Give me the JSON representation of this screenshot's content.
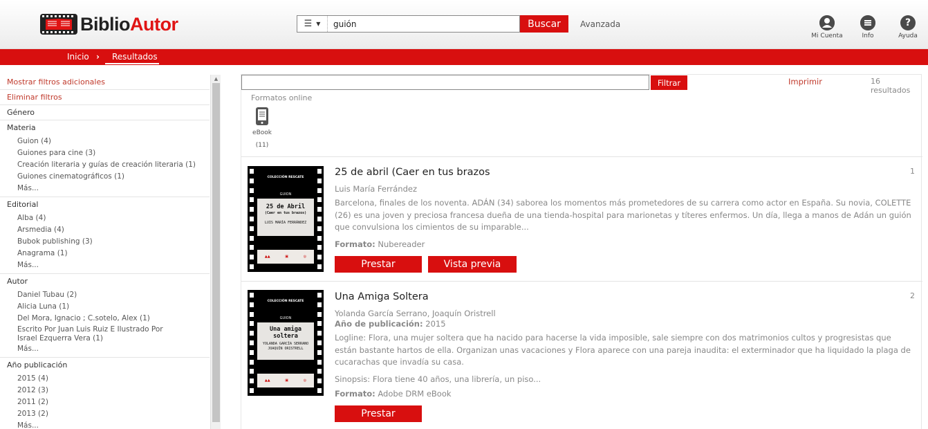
{
  "header": {
    "logo": {
      "part1": "Biblio",
      "part2": "Autor"
    },
    "search": {
      "value": "guión",
      "button": "Buscar",
      "menu_icon": "hamburger-icon"
    },
    "advanced": "Avanzada",
    "icons": [
      {
        "label": "Mi Cuenta",
        "icon": "user-icon"
      },
      {
        "label": "Info",
        "icon": "menu-icon"
      },
      {
        "label": "Ayuda",
        "icon": "help-icon"
      }
    ]
  },
  "nav": {
    "home": "Inicio",
    "separator": "›",
    "current": "Resultados"
  },
  "sidebar": {
    "more_filters": "Mostrar filtros adicionales",
    "clear_filters": "Eliminar filtros",
    "genre": "Género",
    "materia": {
      "title": "Materia",
      "items": [
        "Guion (4)",
        "Guiones para cine (3)",
        "Creación literaria y guías de creación literaria (1)",
        "Guiones cinematográficos (1)"
      ],
      "more": "Más..."
    },
    "editorial": {
      "title": "Editorial",
      "items": [
        "Alba (4)",
        "Arsmedia (4)",
        "Bubok publishing (3)",
        "Anagrama (1)"
      ],
      "more": "Más..."
    },
    "autor": {
      "title": "Autor",
      "items": [
        "Daniel Tubau (2)",
        "Alicia Luna (1)",
        "Del Mora, Ignacio ; C.sotelo, Alex (1)",
        "Escrito Por Juan Luis Ruiz E Ilustrado Por Israel Ezquerra Vera (1)"
      ],
      "more": "Más..."
    },
    "year": {
      "title": "Año publicación",
      "items": [
        "2015 (4)",
        "2012 (3)",
        "2011 (2)",
        "2013 (2)"
      ],
      "more": "Más..."
    }
  },
  "results": {
    "filter_button": "Filtrar",
    "print": "Imprimir",
    "count": "16 resultados",
    "formats_label": "Formatos online",
    "ebook_label": "eBook",
    "ebook_count": "(11)",
    "items": [
      {
        "number": "1",
        "title": "25 de abril (Caer en tus brazos",
        "author": "Luis María Ferrández",
        "description": "Barcelona, finales de los noventa. ADÁN (34) saborea los momentos más prometedores de su carrera como actor en España. Su novia, COLETTE (26) es una joven y preciosa francesa dueña de una tienda-hospital para marionetas y títeres enfermos. Un día, llega a manos de Adán un guión que convulsiona los cimientos de su imparable...",
        "format_label": "Formato:",
        "format_value": "Nubereader",
        "borrow": "Prestar",
        "preview": "Vista previa",
        "cover": {
          "collection": "COLECCIÓN RESCATE",
          "genre": "GUION",
          "title": "25 de Abril",
          "subtitle": "(Caer en tus brazos)",
          "author": "LUIS MARÍA FERRÁNDEZ"
        }
      },
      {
        "number": "2",
        "title": "Una Amiga Soltera",
        "author": "Yolanda García Serrano, Joaquín Oristrell",
        "year_label": "Año de publicación:",
        "year_value": "2015",
        "description": "Logline: Flora, una mujer soltera que ha nacido para hacerse la vida imposible, sale siempre con dos matrimonios cultos y progresistas que están bastante hartos de ella. Organizan unas vacaciones y Flora aparece con una pareja inaudita: el exterminador que ha liquidado la plaga de cucarachas que invadía su casa.",
        "synopsis": "Sinopsis: Flora tiene 40 años, una librería, un piso...",
        "format_label": "Formato:",
        "format_value": "Adobe DRM eBook",
        "borrow": "Prestar",
        "cover": {
          "collection": "COLECCIÓN RESCATE",
          "genre": "GUION",
          "title": "Una amiga",
          "title2": "soltera",
          "author": "YOLANDA GARCÍA SERRANO",
          "author2": "JOAQUÍN ORISTRELL"
        }
      }
    ]
  },
  "colors": {
    "brand_red": "#d80f0f",
    "link_red": "#c0392b"
  }
}
